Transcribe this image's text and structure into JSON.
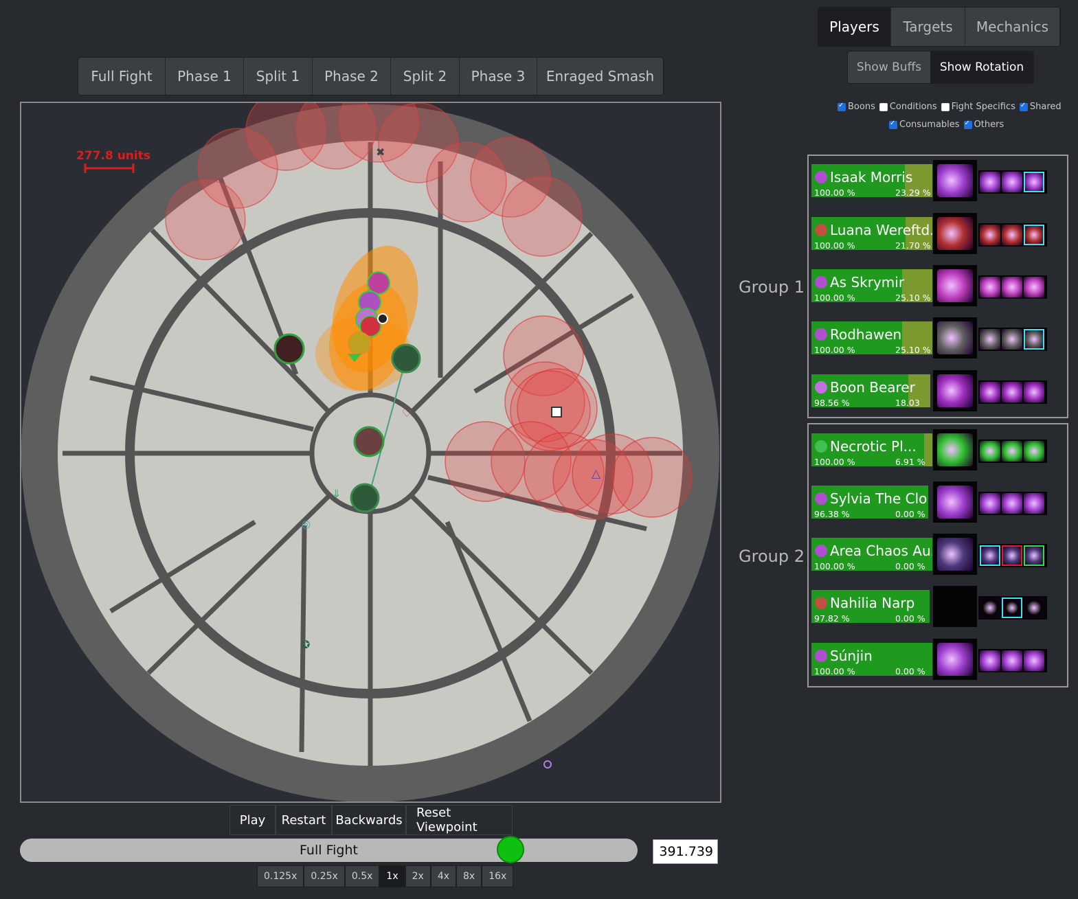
{
  "phases": [
    "Full Fight",
    "Phase 1",
    "Split 1",
    "Phase 2",
    "Split 2",
    "Phase 3",
    "Enraged Smash"
  ],
  "map": {
    "scale_label": "277.8 units"
  },
  "controls": {
    "play": "Play",
    "restart": "Restart",
    "backwards": "Backwards",
    "reset_viewpoint": "Reset Viewpoint"
  },
  "timeline": {
    "label": "Full Fight",
    "time": "391.739",
    "progress": 0.79
  },
  "speeds": [
    "0.125x",
    "0.25x",
    "0.5x",
    "1x",
    "2x",
    "4x",
    "8x",
    "16x"
  ],
  "speed_selected": "1x",
  "tabs": {
    "main": [
      "Players",
      "Targets",
      "Mechanics"
    ],
    "main_selected": "Players",
    "sub": [
      "Show Buffs",
      "Show Rotation"
    ],
    "sub_selected": "Show Rotation"
  },
  "filters": [
    {
      "label": "Boons",
      "checked": true
    },
    {
      "label": "Conditions",
      "checked": false
    },
    {
      "label": "Fight Specifics",
      "checked": false
    },
    {
      "label": "Shared",
      "checked": true
    },
    {
      "label": "Consumables",
      "checked": true
    },
    {
      "label": "Others",
      "checked": true
    }
  ],
  "groups": [
    {
      "label": "Group 1",
      "players": [
        {
          "name": "Isaak Morris",
          "health": "100.00 %",
          "barrier": "23.29 %",
          "icon": "mesmer-icon",
          "color": "#b050d0"
        },
        {
          "name": "Luana Wereftd...",
          "health": "100.00 %",
          "barrier": "21.70 %",
          "icon": "thief-icon",
          "color": "#c05040"
        },
        {
          "name": "As Skrymir",
          "health": "100.00 %",
          "barrier": "25.10 %",
          "icon": "mesmer-icon",
          "color": "#b050d0"
        },
        {
          "name": "Rodhawen",
          "health": "100.00 %",
          "barrier": "25.10 %",
          "icon": "mesmer-icon",
          "color": "#b050d0"
        },
        {
          "name": "Boon Bearer",
          "health": "98.56 %",
          "barrier": "18.03 %",
          "icon": "chronomancer-icon",
          "color": "#c070e0"
        }
      ]
    },
    {
      "label": "Group 2",
      "players": [
        {
          "name": "Necrotic Pl...",
          "health": "100.00 %",
          "barrier": "6.91 %",
          "icon": "necromancer-icon",
          "color": "#40c050"
        },
        {
          "name": "Sylvia The Clone",
          "health": "96.38 %",
          "barrier": "0.00 %",
          "icon": "mesmer-icon",
          "color": "#b050d0"
        },
        {
          "name": "Area Chaos Au...",
          "health": "100.00 %",
          "barrier": "0.00 %",
          "icon": "mesmer-icon",
          "color": "#b050d0"
        },
        {
          "name": "Nahilia Narp",
          "health": "97.82 %",
          "barrier": "0.00 %",
          "icon": "thief-icon",
          "color": "#c05040"
        },
        {
          "name": "Súnjin",
          "health": "100.00 %",
          "barrier": "0.00 %",
          "icon": "mesmer-icon",
          "color": "#b050d0"
        }
      ]
    }
  ]
}
